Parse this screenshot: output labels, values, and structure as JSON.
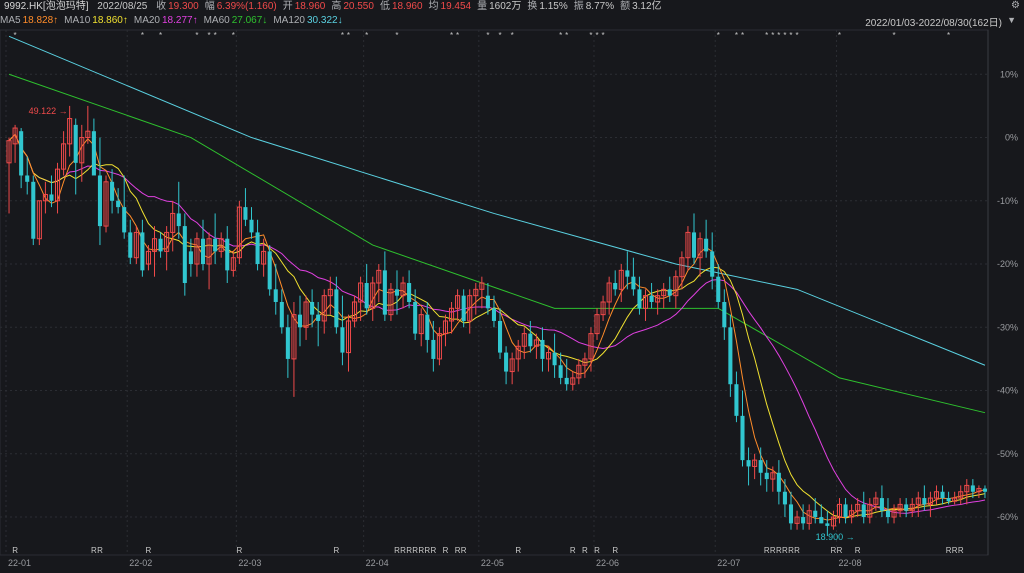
{
  "header": {
    "ticker": "9992.HK[泡泡玛特]",
    "date": "2022/08/25",
    "fields": [
      {
        "label": "收",
        "value": "19.300",
        "color": "#f04a4a"
      },
      {
        "label": "幅",
        "value": "6.39%(1.160)",
        "color": "#f04a4a"
      },
      {
        "label": "开",
        "value": "18.960",
        "color": "#f04a4a"
      },
      {
        "label": "高",
        "value": "20.550",
        "color": "#f04a4a"
      },
      {
        "label": "低",
        "value": "18.960",
        "color": "#f04a4a"
      },
      {
        "label": "均",
        "value": "19.454",
        "color": "#f04a4a"
      },
      {
        "label": "量",
        "value": "1602万",
        "color": "#c8c8c8"
      },
      {
        "label": "换",
        "value": "1.15%",
        "color": "#c8c8c8"
      },
      {
        "label": "振",
        "value": "8.77%",
        "color": "#c8c8c8"
      },
      {
        "label": "额",
        "value": "3.12亿",
        "color": "#c8c8c8"
      }
    ],
    "gear_icon": "gear-icon",
    "range": "2022/01/03-2022/08/30(162日)",
    "triangle_icon": "triangle-down-icon"
  },
  "ma_legend": [
    {
      "label": "MA5",
      "value": "18.828↑",
      "color": "#ff8c2a"
    },
    {
      "label": "MA10",
      "value": "18.860↑",
      "color": "#f0e030"
    },
    {
      "label": "MA20",
      "value": "18.277↑",
      "color": "#e040e0"
    },
    {
      "label": "MA60",
      "value": "27.067↓",
      "color": "#2ec02e"
    },
    {
      "label": "MA120",
      "value": "30.322↓",
      "color": "#5ad0e0"
    }
  ],
  "chart_data": {
    "type": "candlestick",
    "y_axis_labels": [
      "10%",
      "0%",
      "-10%",
      "-20%",
      "-30%",
      "-40%",
      "-50%",
      "-60%"
    ],
    "y_axis_values": [
      10,
      0,
      -10,
      -20,
      -30,
      -40,
      -50,
      -60
    ],
    "ylim": [
      -66,
      17
    ],
    "x_labels": [
      {
        "label": "22-01",
        "index": 0
      },
      {
        "label": "22-02",
        "index": 20
      },
      {
        "label": "22-03",
        "index": 38
      },
      {
        "label": "22-04",
        "index": 59
      },
      {
        "label": "22-05",
        "index": 78
      },
      {
        "label": "22-06",
        "index": 97
      },
      {
        "label": "22-07",
        "index": 117
      },
      {
        "label": "22-08",
        "index": 137
      }
    ],
    "base_price": 49.0,
    "max_label": {
      "text": "49.122",
      "index": 10,
      "value": 0.2
    },
    "min_label": {
      "text": "18.900",
      "index": 140,
      "value": -61.4
    },
    "colors": {
      "up": "#f04a4a",
      "down": "#31c6cf",
      "grid": "#2b2d33"
    },
    "star_marks": "*",
    "r_marks": "R",
    "star_indices": [
      1,
      22,
      25,
      31,
      33,
      34,
      37,
      55,
      56,
      59,
      64,
      73,
      74,
      79,
      81,
      83,
      91,
      92,
      96,
      97,
      98,
      117,
      120,
      121,
      125,
      126,
      127,
      128,
      129,
      130,
      137,
      146,
      155
    ],
    "r_indices": [
      1,
      14,
      15,
      23,
      38,
      54,
      64,
      65,
      66,
      67,
      68,
      69,
      70,
      72,
      74,
      75,
      84,
      93,
      95,
      97,
      100,
      125,
      126,
      127,
      128,
      129,
      130,
      136,
      137,
      140,
      155,
      156,
      157
    ],
    "candles": [
      [
        -4,
        0,
        -12,
        -0.5
      ],
      [
        -1,
        2,
        -4,
        1.5
      ],
      [
        1,
        1.5,
        -8,
        -6
      ],
      [
        -6,
        -3,
        -9,
        -7
      ],
      [
        -7,
        -6,
        -17,
        -16
      ],
      [
        -16,
        -10,
        -17,
        -10
      ],
      [
        -10,
        -7,
        -12,
        -9
      ],
      [
        -9,
        -6,
        -11,
        -10
      ],
      [
        -10,
        -4,
        -12,
        -5
      ],
      [
        -5,
        1,
        -6,
        -1
      ],
      [
        -1,
        5,
        -3,
        3
      ],
      [
        2,
        3,
        -9,
        -4
      ],
      [
        -4,
        2,
        -7,
        0
      ],
      [
        0,
        5,
        -1,
        1
      ],
      [
        1,
        3,
        -4,
        -6
      ],
      [
        -6,
        0,
        -17,
        -14
      ],
      [
        -14,
        -6,
        -15,
        -7
      ],
      [
        -7,
        -5,
        -12,
        -10
      ],
      [
        -10,
        -8,
        -12,
        -11
      ],
      [
        -11,
        -6,
        -16,
        -15
      ],
      [
        -15,
        -13,
        -20,
        -19
      ],
      [
        -19,
        -14,
        -20,
        -15
      ],
      [
        -15,
        -13,
        -22,
        -21
      ],
      [
        -20,
        -17,
        -21,
        -18
      ],
      [
        -18,
        -14,
        -22,
        -16
      ],
      [
        -16,
        -15,
        -19,
        -18
      ],
      [
        -18,
        -14,
        -21,
        -15
      ],
      [
        -15,
        -10,
        -18,
        -12
      ],
      [
        -12,
        -7,
        -16,
        -14
      ],
      [
        -14,
        -12,
        -25,
        -23
      ],
      [
        -18,
        -16,
        -22,
        -20
      ],
      [
        -20,
        -15,
        -22,
        -16
      ],
      [
        -16,
        -13,
        -21,
        -20
      ],
      [
        -20,
        -15,
        -24,
        -16
      ],
      [
        -16,
        -12,
        -20,
        -18
      ],
      [
        -18,
        -15,
        -19,
        -16
      ],
      [
        -16,
        -14,
        -23,
        -21
      ],
      [
        -21,
        -18,
        -22,
        -19
      ],
      [
        -19,
        -10,
        -20,
        -11
      ],
      [
        -11,
        -8,
        -14,
        -13
      ],
      [
        -13,
        -11,
        -16,
        -15
      ],
      [
        -15,
        -13,
        -21,
        -20
      ],
      [
        -20,
        -16,
        -22,
        -18
      ],
      [
        -18,
        -17,
        -25,
        -24
      ],
      [
        -24,
        -20,
        -28,
        -26
      ],
      [
        -26,
        -24,
        -31,
        -30
      ],
      [
        -30,
        -28,
        -38,
        -35
      ],
      [
        -35,
        -26,
        -41,
        -28
      ],
      [
        -28,
        -25,
        -33,
        -30
      ],
      [
        -30,
        -25,
        -32,
        -26
      ],
      [
        -26,
        -24,
        -30,
        -28
      ],
      [
        -28,
        -26,
        -33,
        -29
      ],
      [
        -29,
        -24,
        -31,
        -25
      ],
      [
        -25,
        -22,
        -28,
        -24
      ],
      [
        -24,
        -22,
        -31,
        -30
      ],
      [
        -30,
        -25,
        -36,
        -34
      ],
      [
        -34,
        -28,
        -37,
        -29
      ],
      [
        -29,
        -25,
        -30,
        -26
      ],
      [
        -26,
        -22,
        -29,
        -23
      ],
      [
        -23,
        -20,
        -28,
        -27
      ],
      [
        -27,
        -22,
        -29,
        -23
      ],
      [
        -23,
        -20,
        -26,
        -21
      ],
      [
        -21,
        -18,
        -29,
        -28
      ],
      [
        -28,
        -23,
        -29,
        -24
      ],
      [
        -24,
        -21,
        -28,
        -25
      ],
      [
        -25,
        -22,
        -27,
        -23
      ],
      [
        -23,
        -21,
        -27,
        -26
      ],
      [
        -26,
        -24,
        -32,
        -31
      ],
      [
        -31,
        -27,
        -33,
        -28
      ],
      [
        -28,
        -26,
        -34,
        -32
      ],
      [
        -32,
        -29,
        -37,
        -35
      ],
      [
        -35,
        -30,
        -36,
        -31
      ],
      [
        -31,
        -28,
        -33,
        -29
      ],
      [
        -29,
        -26,
        -31,
        -27
      ],
      [
        -27,
        -24,
        -29,
        -25
      ],
      [
        -25,
        -24,
        -30,
        -29
      ],
      [
        -29,
        -24,
        -31,
        -25
      ],
      [
        -25,
        -23,
        -28,
        -24
      ],
      [
        -24,
        -22,
        -27,
        -23
      ],
      [
        -25,
        -23,
        -28,
        -27
      ],
      [
        -27,
        -25,
        -30,
        -29
      ],
      [
        -29,
        -27,
        -35,
        -34
      ],
      [
        -34,
        -33,
        -39,
        -37
      ],
      [
        -37,
        -34,
        -39,
        -35
      ],
      [
        -35,
        -32,
        -37,
        -33
      ],
      [
        -33,
        -30,
        -35,
        -31
      ],
      [
        -31,
        -29,
        -34,
        -33
      ],
      [
        -33,
        -31,
        -35,
        -32
      ],
      [
        -32,
        -30,
        -37,
        -35
      ],
      [
        -35,
        -33,
        -37,
        -34
      ],
      [
        -34,
        -31,
        -38,
        -36
      ],
      [
        -36,
        -34,
        -39,
        -38
      ],
      [
        -38,
        -35,
        -40,
        -39
      ],
      [
        -39,
        -37,
        -40,
        -38
      ],
      [
        -38,
        -35,
        -39,
        -36
      ],
      [
        -36,
        -34,
        -38,
        -35
      ],
      [
        -35,
        -30,
        -37,
        -31
      ],
      [
        -31,
        -27,
        -32,
        -28
      ],
      [
        -28,
        -25,
        -29,
        -26
      ],
      [
        -26,
        -22,
        -28,
        -23
      ],
      [
        -23,
        -21,
        -25,
        -24
      ],
      [
        -24,
        -20,
        -26,
        -21
      ],
      [
        -21,
        -18,
        -24,
        -22
      ],
      [
        -22,
        -19,
        -25,
        -24
      ],
      [
        -24,
        -22,
        -28,
        -27
      ],
      [
        -27,
        -24,
        -29,
        -25
      ],
      [
        -25,
        -23,
        -27,
        -26
      ],
      [
        -26,
        -24,
        -28,
        -25
      ],
      [
        -25,
        -23,
        -27,
        -24
      ],
      [
        -24,
        -22,
        -26,
        -25
      ],
      [
        -25,
        -21,
        -27,
        -22
      ],
      [
        -22,
        -18,
        -24,
        -19
      ],
      [
        -19,
        -14,
        -21,
        -15
      ],
      [
        -15,
        -12,
        -20,
        -19
      ],
      [
        -19,
        -15,
        -22,
        -16
      ],
      [
        -16,
        -13,
        -19,
        -18
      ],
      [
        -18,
        -15,
        -24,
        -22
      ],
      [
        -22,
        -20,
        -27,
        -26
      ],
      [
        -26,
        -24,
        -32,
        -30
      ],
      [
        -30,
        -28,
        -41,
        -39
      ],
      [
        -39,
        -37,
        -45,
        -44
      ],
      [
        -44,
        -40,
        -52,
        -51
      ],
      [
        -51,
        -49,
        -55,
        -52
      ],
      [
        -52,
        -50,
        -54,
        -51
      ],
      [
        -51,
        -49,
        -55,
        -53
      ],
      [
        -53,
        -51,
        -56,
        -54
      ],
      [
        -54,
        -52,
        -56,
        -53
      ],
      [
        -53,
        -51,
        -58,
        -56
      ],
      [
        -56,
        -54,
        -60,
        -58
      ],
      [
        -58,
        -56,
        -62,
        -61
      ],
      [
        -61,
        -59,
        -62,
        -60
      ],
      [
        -60,
        -58,
        -62,
        -61
      ],
      [
        -61,
        -58,
        -62,
        -59
      ],
      [
        -59,
        -57,
        -61,
        -60
      ],
      [
        -60,
        -58,
        -61,
        -61
      ],
      [
        -61,
        -59,
        -63,
        -61.4
      ],
      [
        -61.4,
        -59,
        -62,
        -60
      ],
      [
        -60,
        -57,
        -61,
        -58
      ],
      [
        -58,
        -57,
        -61,
        -60
      ],
      [
        -60,
        -58,
        -61,
        -59
      ],
      [
        -59,
        -57,
        -60,
        -58
      ],
      [
        -58,
        -56,
        -61,
        -60
      ],
      [
        -60,
        -57,
        -61,
        -58
      ],
      [
        -58,
        -56,
        -59,
        -57
      ],
      [
        -57,
        -55,
        -60,
        -59
      ],
      [
        -59,
        -57,
        -61,
        -60
      ],
      [
        -60,
        -58,
        -61,
        -59
      ],
      [
        -59,
        -57,
        -60,
        -58
      ],
      [
        -58,
        -57,
        -60,
        -59
      ],
      [
        -59,
        -57,
        -60,
        -58
      ],
      [
        -58,
        -56,
        -60,
        -57
      ],
      [
        -57,
        -55,
        -59,
        -58
      ],
      [
        -58,
        -56,
        -60,
        -57
      ],
      [
        -57,
        -55,
        -58,
        -56
      ],
      [
        -56,
        -55,
        -58,
        -57
      ],
      [
        -57,
        -56,
        -58,
        -57.5
      ],
      [
        -57.5,
        -56,
        -58,
        -57
      ],
      [
        -57,
        -55,
        -58,
        -56
      ],
      [
        -56,
        -54,
        -58,
        -55
      ],
      [
        -55,
        -54,
        -57,
        -56
      ],
      [
        -56,
        -55,
        -57,
        -55.5
      ],
      [
        -55.5,
        -55,
        -57,
        -56
      ]
    ],
    "ma_series": [
      {
        "name": "MA60",
        "color": "#2ec02e",
        "points": [
          [
            0,
            10
          ],
          [
            30,
            0
          ],
          [
            60,
            -17
          ],
          [
            90,
            -27
          ],
          [
            117,
            -27
          ],
          [
            137,
            -38
          ],
          [
            161,
            -43.5
          ]
        ]
      },
      {
        "name": "MA120",
        "color": "#5ad0e0",
        "points": [
          [
            0,
            16
          ],
          [
            40,
            0
          ],
          [
            80,
            -12
          ],
          [
            110,
            -20
          ],
          [
            130,
            -24
          ],
          [
            161,
            -36
          ]
        ]
      }
    ]
  }
}
